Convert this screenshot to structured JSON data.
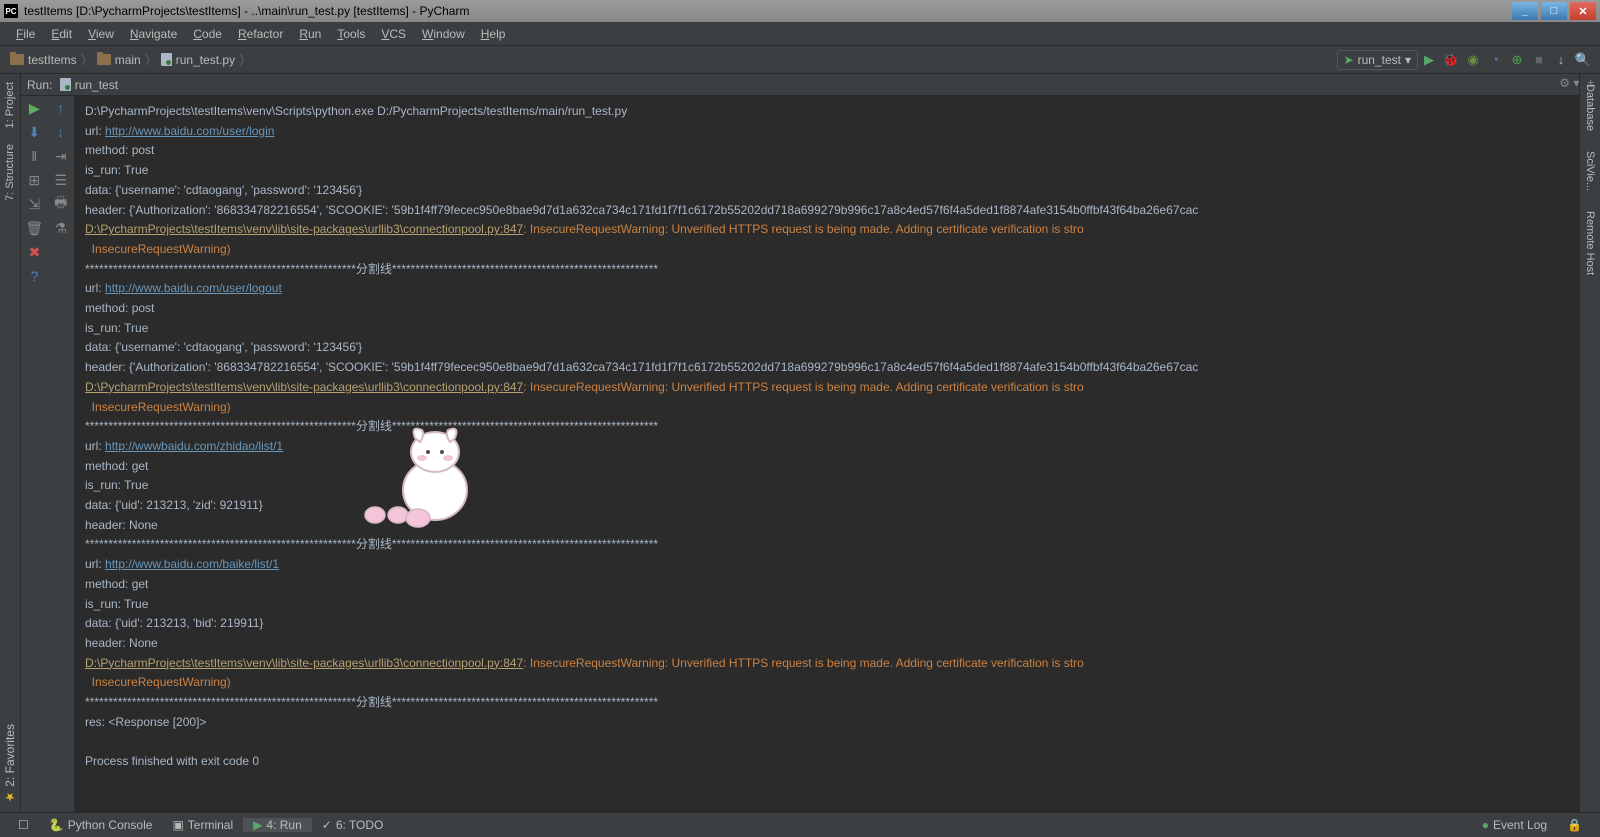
{
  "window": {
    "title": "testItems [D:\\PycharmProjects\\testItems] - ..\\main\\run_test.py [testItems] - PyCharm",
    "app_icon": "PC"
  },
  "menu": [
    "File",
    "Edit",
    "View",
    "Navigate",
    "Code",
    "Refactor",
    "Run",
    "Tools",
    "VCS",
    "Window",
    "Help"
  ],
  "breadcrumb": {
    "root": "testItems",
    "folder": "main",
    "file": "run_test.py"
  },
  "runConfig": "run_test",
  "leftRail": {
    "project": "1: Project",
    "structure": "7: Structure",
    "favorites": "2: Favorites"
  },
  "rightRail": {
    "database": "Database",
    "scivie": "SciVie...",
    "remote": "Remote Host"
  },
  "runHeader": {
    "label": "Run:",
    "target": "run_test"
  },
  "statusbar": {
    "pyconsole": "Python Console",
    "terminal": "Terminal",
    "run": "4: Run",
    "todo": "6: TODO",
    "eventlog": "Event Log"
  },
  "console": {
    "cmd": "D:\\PycharmProjects\\testItems\\venv\\Scripts\\python.exe D:/PycharmProjects/testItems/main/run_test.py",
    "urlLabel": "url: ",
    "methodPost": "method: post",
    "methodGet": "method: get",
    "isRun": "is_run: True",
    "headerNone": "header: None",
    "url1": "http://www.baidu.com/user/login",
    "url2": "http://www.baidu.com/user/logout",
    "url3": "http://wwwbaidu.com/zhidao/list/1",
    "url4": "http://www.baidu.com/baike/list/1",
    "data1": "data: {'username': 'cdtaogang', 'password': '123456'}",
    "data3": "data: {'uid': 213213, 'zid': 921911}",
    "data4": "data: {'uid': 213213, 'bid': 219911}",
    "header1": "header: {'Authorization': '868334782216554', 'SCOOKIE': '59b1f4ff79fecec950e8bae9d7d1a632ca734c171fd1f7f1c6172b55202dd718a699279b996c17a8c4ed57f6f4a5ded1f8874afe3154b0ffbf43f64ba26e67cac",
    "warnPath": "D:\\PycharmProjects\\testItems\\venv\\lib\\site-packages\\urllib3\\connectionpool.py:847",
    "warnMsg": ": InsecureRequestWarning: Unverified HTTPS request is being made. Adding certificate verification is stro",
    "warnTail": "  InsecureRequestWarning)",
    "sep": "**********************************************************分割线*********************************************************",
    "res": "res: <Response [200]>",
    "exit": "Process finished with exit code 0"
  }
}
